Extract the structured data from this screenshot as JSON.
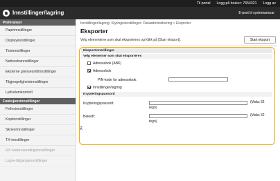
{
  "topbar": {
    "portal": "Til portal",
    "logon_user": "Logg på bruker: 7654321",
    "logout": "Logg av"
  },
  "header": {
    "title": "Innstillinger/lagring",
    "email": "E-post til systemansvar"
  },
  "sidebar": {
    "section1": "Preferanser",
    "items1": [
      "Papirinnstillinger",
      "Displayinnstillinger",
      "Tidsinnstillinger",
      "Nettverksinnstillinger",
      "Eksterne grensesnittinnstillinger",
      "Tilgjengelighetsinnstillinger",
      "Lydvolumkontroll"
    ],
    "section2": "Funksjonsinnstillinger",
    "items2": [
      "Fellesinnstillinger",
      "Kopiinnstillinger",
      "Skriverinnstillinger",
      "TX-innstillinger",
      "RX-/videresendingsinnstillinger",
      "Lagre-/tilgangsinnstillinger"
    ]
  },
  "main": {
    "breadcrumb": "Innstillinger/lagring: Styringsinnstillinger: Dataadministrering > Eksporter",
    "title": "Eksporter",
    "instruction": "Velg elementene som skal eksporteres og klikk på [Start eksport].",
    "start_button": "Start eksport"
  },
  "export": {
    "header": "Eksportinnstillinger",
    "subheader": "Velg elementer som skal eksporteres",
    "options": [
      {
        "label": "Adressebok (ABK)",
        "checked": false
      },
      {
        "label": "Adressebok",
        "checked": true
      },
      {
        "label": "Innstillinger/lagring",
        "checked": true
      }
    ],
    "pin_label": "PIN-kode for adressebok:",
    "encryption_header": "Krypteringspassord",
    "password_label": "Krypteringspassord:",
    "confirm_label": "Bekreft:",
    "max_note_1": "(Maks 32",
    "max_note_2": "tegn)"
  },
  "footer_mark": "⊼"
}
